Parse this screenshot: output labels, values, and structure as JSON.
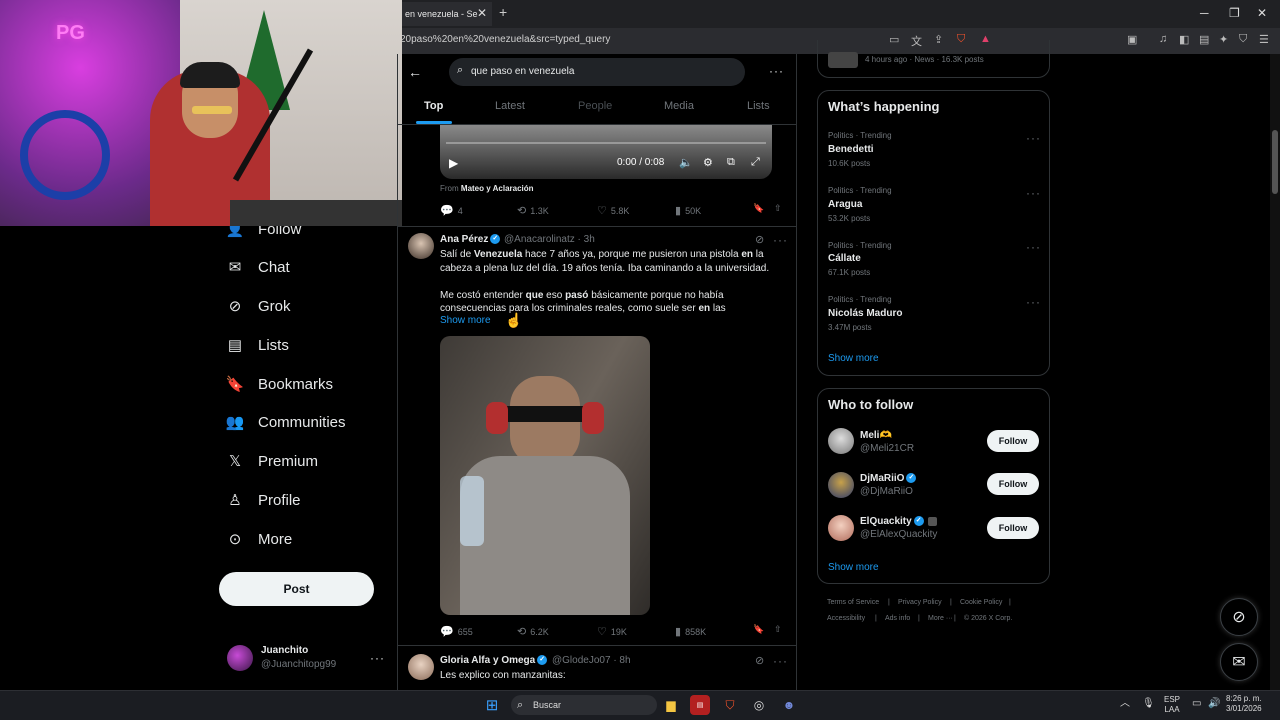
{
  "browser": {
    "tab_title": "en venezuela - Se",
    "url": "20paso%20en%20venezuela&src=typed_query"
  },
  "nav": {
    "items": [
      {
        "label": "Follow",
        "icon": "follow-icon"
      },
      {
        "label": "Chat",
        "icon": "mail-icon"
      },
      {
        "label": "Grok",
        "icon": "grok-icon"
      },
      {
        "label": "Lists",
        "icon": "list-icon"
      },
      {
        "label": "Bookmarks",
        "icon": "bookmark-icon"
      },
      {
        "label": "Communities",
        "icon": "people-icon"
      },
      {
        "label": "Premium",
        "icon": "x-icon"
      },
      {
        "label": "Profile",
        "icon": "person-icon"
      },
      {
        "label": "More",
        "icon": "more-circle-icon"
      }
    ],
    "post_label": "Post",
    "account": {
      "name": "Juanchito",
      "handle": "@Juanchitopg99"
    }
  },
  "search": {
    "query": "que paso en venezuela",
    "tabs": [
      "Top",
      "Latest",
      "People",
      "Media",
      "Lists"
    ],
    "active_tab": "Top"
  },
  "video_tweet": {
    "time": "0:00 / 0:08",
    "from_prefix": "From",
    "from_source": "Mateo y Aclaración",
    "replies": "4",
    "reposts": "1.3K",
    "likes": "5.8K",
    "views": "50K"
  },
  "tweet1": {
    "name": "Ana Pérez",
    "handle": "@Anacarolinatz",
    "time": "· 3h",
    "line1_a": "Salí de ",
    "line1_b": "Venezuela",
    "line1_c": " hace 7 años ya, porque me pusieron una pistola ",
    "line1_d": "en",
    "line1_e": " la",
    "line2": "cabeza a plena luz del día. 19 años tenía. Iba caminando a la universidad.",
    "line3_a": "Me costó entender ",
    "line3_b": "que",
    "line3_c": " eso ",
    "line3_d": "pasó",
    "line3_e": " básicamente porque no había",
    "line4_a": "consecuencias para los criminales reales, como suele ser ",
    "line4_b": "en",
    "line4_c": " las",
    "show_more": "Show more",
    "replies": "655",
    "reposts": "6.2K",
    "likes": "19K",
    "views": "858K"
  },
  "tweet2": {
    "name": "Gloria Alfa y Omega",
    "handle": "@GlodeJo07",
    "time": "· 8h",
    "text": "Les explico con manzanitas:"
  },
  "top_snippet": "4 hours ago · News · 16.3K posts",
  "happening": {
    "title": "What’s happening",
    "trends": [
      {
        "meta": "Politics · Trending",
        "name": "Benedetti",
        "posts": "10.6K posts"
      },
      {
        "meta": "Politics · Trending",
        "name": "Aragua",
        "posts": "53.2K posts"
      },
      {
        "meta": "Politics · Trending",
        "name": "Cállate",
        "posts": "67.1K posts"
      },
      {
        "meta": "Politics · Trending",
        "name": "Nicolás Maduro",
        "posts": "3.47M posts"
      }
    ],
    "show_more": "Show more"
  },
  "who_to_follow": {
    "title": "Who to follow",
    "users": [
      {
        "name": "Meli🫶",
        "handle": "@Meli21CR",
        "button": "Follow"
      },
      {
        "name": "DjMaRiiO",
        "handle": "@DjMaRiiO",
        "button": "Follow"
      },
      {
        "name": "ElQuackity",
        "handle": "@ElAlexQuackity",
        "button": "Follow"
      }
    ],
    "show_more": "Show more"
  },
  "footer": {
    "links": [
      "Terms of Service",
      "Privacy Policy",
      "Cookie Policy",
      "Accessibility",
      "Ads info",
      "More ···",
      "© 2026 X Corp."
    ]
  },
  "taskbar": {
    "search_label": "Buscar",
    "lang_top": "ESP",
    "lang_bottom": "LAA",
    "time": "8:26 p. m.",
    "date": "3/01/2026"
  },
  "colors": {
    "accent": "#1d9bf0",
    "background": "#000000",
    "muted": "#71767b"
  }
}
